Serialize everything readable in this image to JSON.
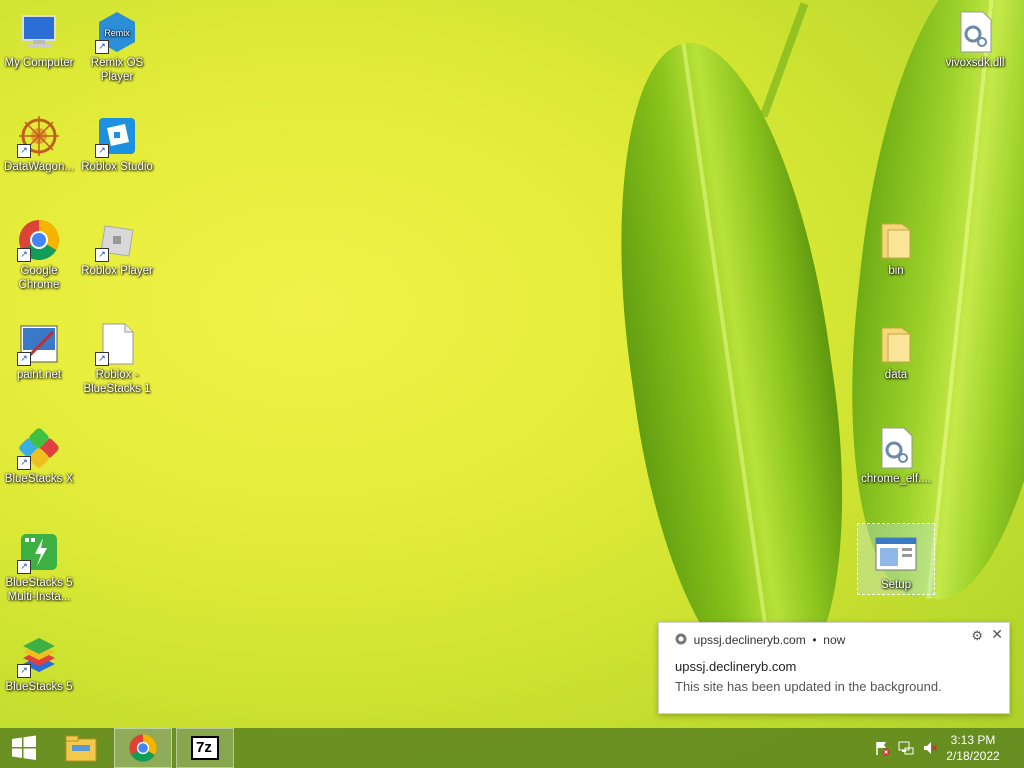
{
  "desktop": {
    "left_icons": [
      {
        "name": "my-computer",
        "label": "My Computer"
      },
      {
        "name": "remix-os-player",
        "label": "Remix OS Player"
      },
      {
        "name": "datawagon",
        "label": "DataWagon..."
      },
      {
        "name": "roblox-studio",
        "label": "Roblox Studio"
      },
      {
        "name": "google-chrome",
        "label": "Google Chrome"
      },
      {
        "name": "roblox-player",
        "label": "Roblox Player"
      },
      {
        "name": "paint-net",
        "label": "paint.net"
      },
      {
        "name": "roblox-bluestacks",
        "label": "Roblox - BlueStacks 1"
      },
      {
        "name": "bluestacks-x",
        "label": "BlueStacks X"
      },
      {
        "name": "bluestacks-5-multi",
        "label": "BlueStacks 5 Multi-Insta..."
      },
      {
        "name": "bluestacks-5",
        "label": "BlueStacks 5"
      }
    ],
    "right_icons": [
      {
        "name": "vivoxsdk-dll",
        "label": "vivoxsdk.dll"
      },
      {
        "name": "bin-folder",
        "label": "bin"
      },
      {
        "name": "data-folder",
        "label": "data"
      },
      {
        "name": "chrome-elf",
        "label": "chrome_elf...."
      },
      {
        "name": "setup",
        "label": "Setup"
      }
    ]
  },
  "notification": {
    "source": "upssj.declineryb.com",
    "dot": "•",
    "time": "now",
    "title": "upssj.declineryb.com",
    "body": "This site has been updated in the background.",
    "gear_icon": "⚙",
    "close_icon": "✕"
  },
  "taskbar": {
    "start_icon": "windows-logo",
    "apps": [
      "file-explorer",
      "google-chrome",
      "7-zip"
    ],
    "seven_zip_label": "7z",
    "clock_time": "3:13 PM",
    "clock_date": "2/18/2022"
  },
  "colors": {
    "taskbar": "#5a821e",
    "chrome_red": "#db4437",
    "chrome_green": "#0f9d58",
    "chrome_yellow": "#f4b400",
    "chrome_blue": "#4285f4"
  }
}
